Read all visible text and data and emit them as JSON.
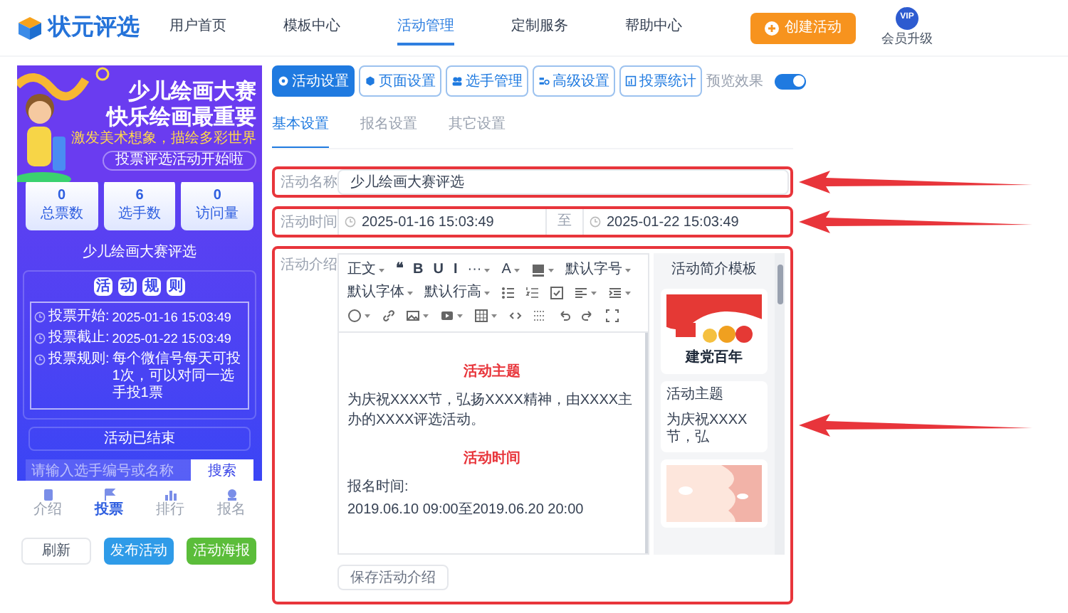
{
  "header": {
    "logo": "状元评选",
    "nav": [
      {
        "label": "用户首页",
        "selected": false
      },
      {
        "label": "模板中心",
        "selected": false
      },
      {
        "label": "活动管理",
        "selected": true
      },
      {
        "label": "定制服务",
        "selected": false
      },
      {
        "label": "帮助中心",
        "selected": false
      }
    ],
    "create_button": "创建活动",
    "vip_badge": "VIP",
    "vip_label": "会员升级"
  },
  "preview": {
    "banner_title": [
      "少儿绘画大赛",
      "快乐绘画最重要"
    ],
    "banner_subtitle": "激发美术想象，描绘多彩世界",
    "banner_tag": "投票评选活动开始啦",
    "stats": [
      {
        "value": "0",
        "label": "总票数"
      },
      {
        "value": "6",
        "label": "选手数"
      },
      {
        "value": "0",
        "label": "访问量"
      }
    ],
    "title": "少儿绘画大赛评选",
    "rules_heading": [
      "活",
      "动",
      "规",
      "则"
    ],
    "rules": [
      {
        "label": "投票开始:",
        "value": "2025-01-16 15:03:49"
      },
      {
        "label": "投票截止:",
        "value": "2025-01-22 15:03:49"
      },
      {
        "label": "投票规则:",
        "value": "每个微信号每天可投1次，可以对同一选手投1票"
      }
    ],
    "status": "活动已结束",
    "search_placeholder": "请输入选手编号或名称",
    "search_button": "搜索",
    "bottom_nav": [
      {
        "label": "介绍",
        "selected": false
      },
      {
        "label": "投票",
        "selected": true
      },
      {
        "label": "排行",
        "selected": false
      },
      {
        "label": "报名",
        "selected": false
      }
    ],
    "buttons": [
      {
        "label": "刷新",
        "kind": "plain"
      },
      {
        "label": "发布活动",
        "kind": "blue"
      },
      {
        "label": "活动海报",
        "kind": "green"
      }
    ]
  },
  "tool_tabs": [
    {
      "label": "活动设置",
      "selected": true
    },
    {
      "label": "页面设置",
      "selected": false
    },
    {
      "label": "选手管理",
      "selected": false
    },
    {
      "label": "高级设置",
      "selected": false
    },
    {
      "label": "投票统计",
      "selected": false
    }
  ],
  "preview_toggle": {
    "label": "预览效果",
    "on": true
  },
  "sub_tabs": [
    {
      "label": "基本设置",
      "selected": true
    },
    {
      "label": "报名设置",
      "selected": false
    },
    {
      "label": "其它设置",
      "selected": false
    }
  ],
  "name_field": {
    "label": "活动名称",
    "value": "少儿绘画大赛评选",
    "highlighted": true
  },
  "time_field": {
    "label": "活动时间",
    "start": "2025-01-16 15:03:49",
    "separator": "至",
    "end": "2025-01-22 15:03:49",
    "highlighted": true
  },
  "intro_field": {
    "label": "活动介绍",
    "highlighted": true,
    "toolbar": [
      {
        "kind": "dropdown",
        "label": "正文"
      },
      {
        "kind": "glyph",
        "label": "❝"
      },
      {
        "kind": "glyph",
        "label": "B"
      },
      {
        "kind": "glyph",
        "label": "U"
      },
      {
        "kind": "glyph",
        "label": "I"
      },
      {
        "kind": "dropdown",
        "label": "···"
      },
      {
        "kind": "dropdown",
        "label": "A"
      },
      {
        "kind": "icon-dropdown"
      },
      {
        "kind": "dropdown",
        "label": "默认字号"
      },
      {
        "kind": "dropdown",
        "label": "默认字体"
      },
      {
        "kind": "dropdown",
        "label": "默认行高"
      },
      {
        "kind": "icon"
      },
      {
        "kind": "icon"
      },
      {
        "kind": "icon"
      },
      {
        "kind": "icon-dropdown"
      },
      {
        "kind": "icon-dropdown"
      },
      {
        "kind": "icon-dropdown"
      },
      {
        "kind": "icon"
      },
      {
        "kind": "icon-dropdown"
      },
      {
        "kind": "icon-dropdown"
      },
      {
        "kind": "icon-dropdown"
      },
      {
        "kind": "icon"
      },
      {
        "kind": "icon"
      },
      {
        "kind": "icon"
      },
      {
        "kind": "icon"
      },
      {
        "kind": "icon"
      }
    ],
    "content": [
      {
        "kind": "heading",
        "text": "活动主题"
      },
      {
        "kind": "paragraph",
        "text": "为庆祝XXXX节，弘扬XXXX精神，由XXXX主办的XXXX评选活动。"
      },
      {
        "kind": "heading",
        "text": "活动时间"
      },
      {
        "kind": "paragraph",
        "text": "报名时间:"
      },
      {
        "kind": "paragraph",
        "text": "2019.06.10 09:00至2019.06.20 20:00"
      }
    ],
    "templates_title": "活动简介模板",
    "templates": [
      {
        "kind": "picture",
        "caption": "建党百年"
      },
      {
        "kind": "text",
        "lines": [
          "活动主题",
          "为庆祝XXXX节，弘"
        ]
      },
      {
        "kind": "picture"
      }
    ],
    "save_button": "保存活动介绍"
  }
}
